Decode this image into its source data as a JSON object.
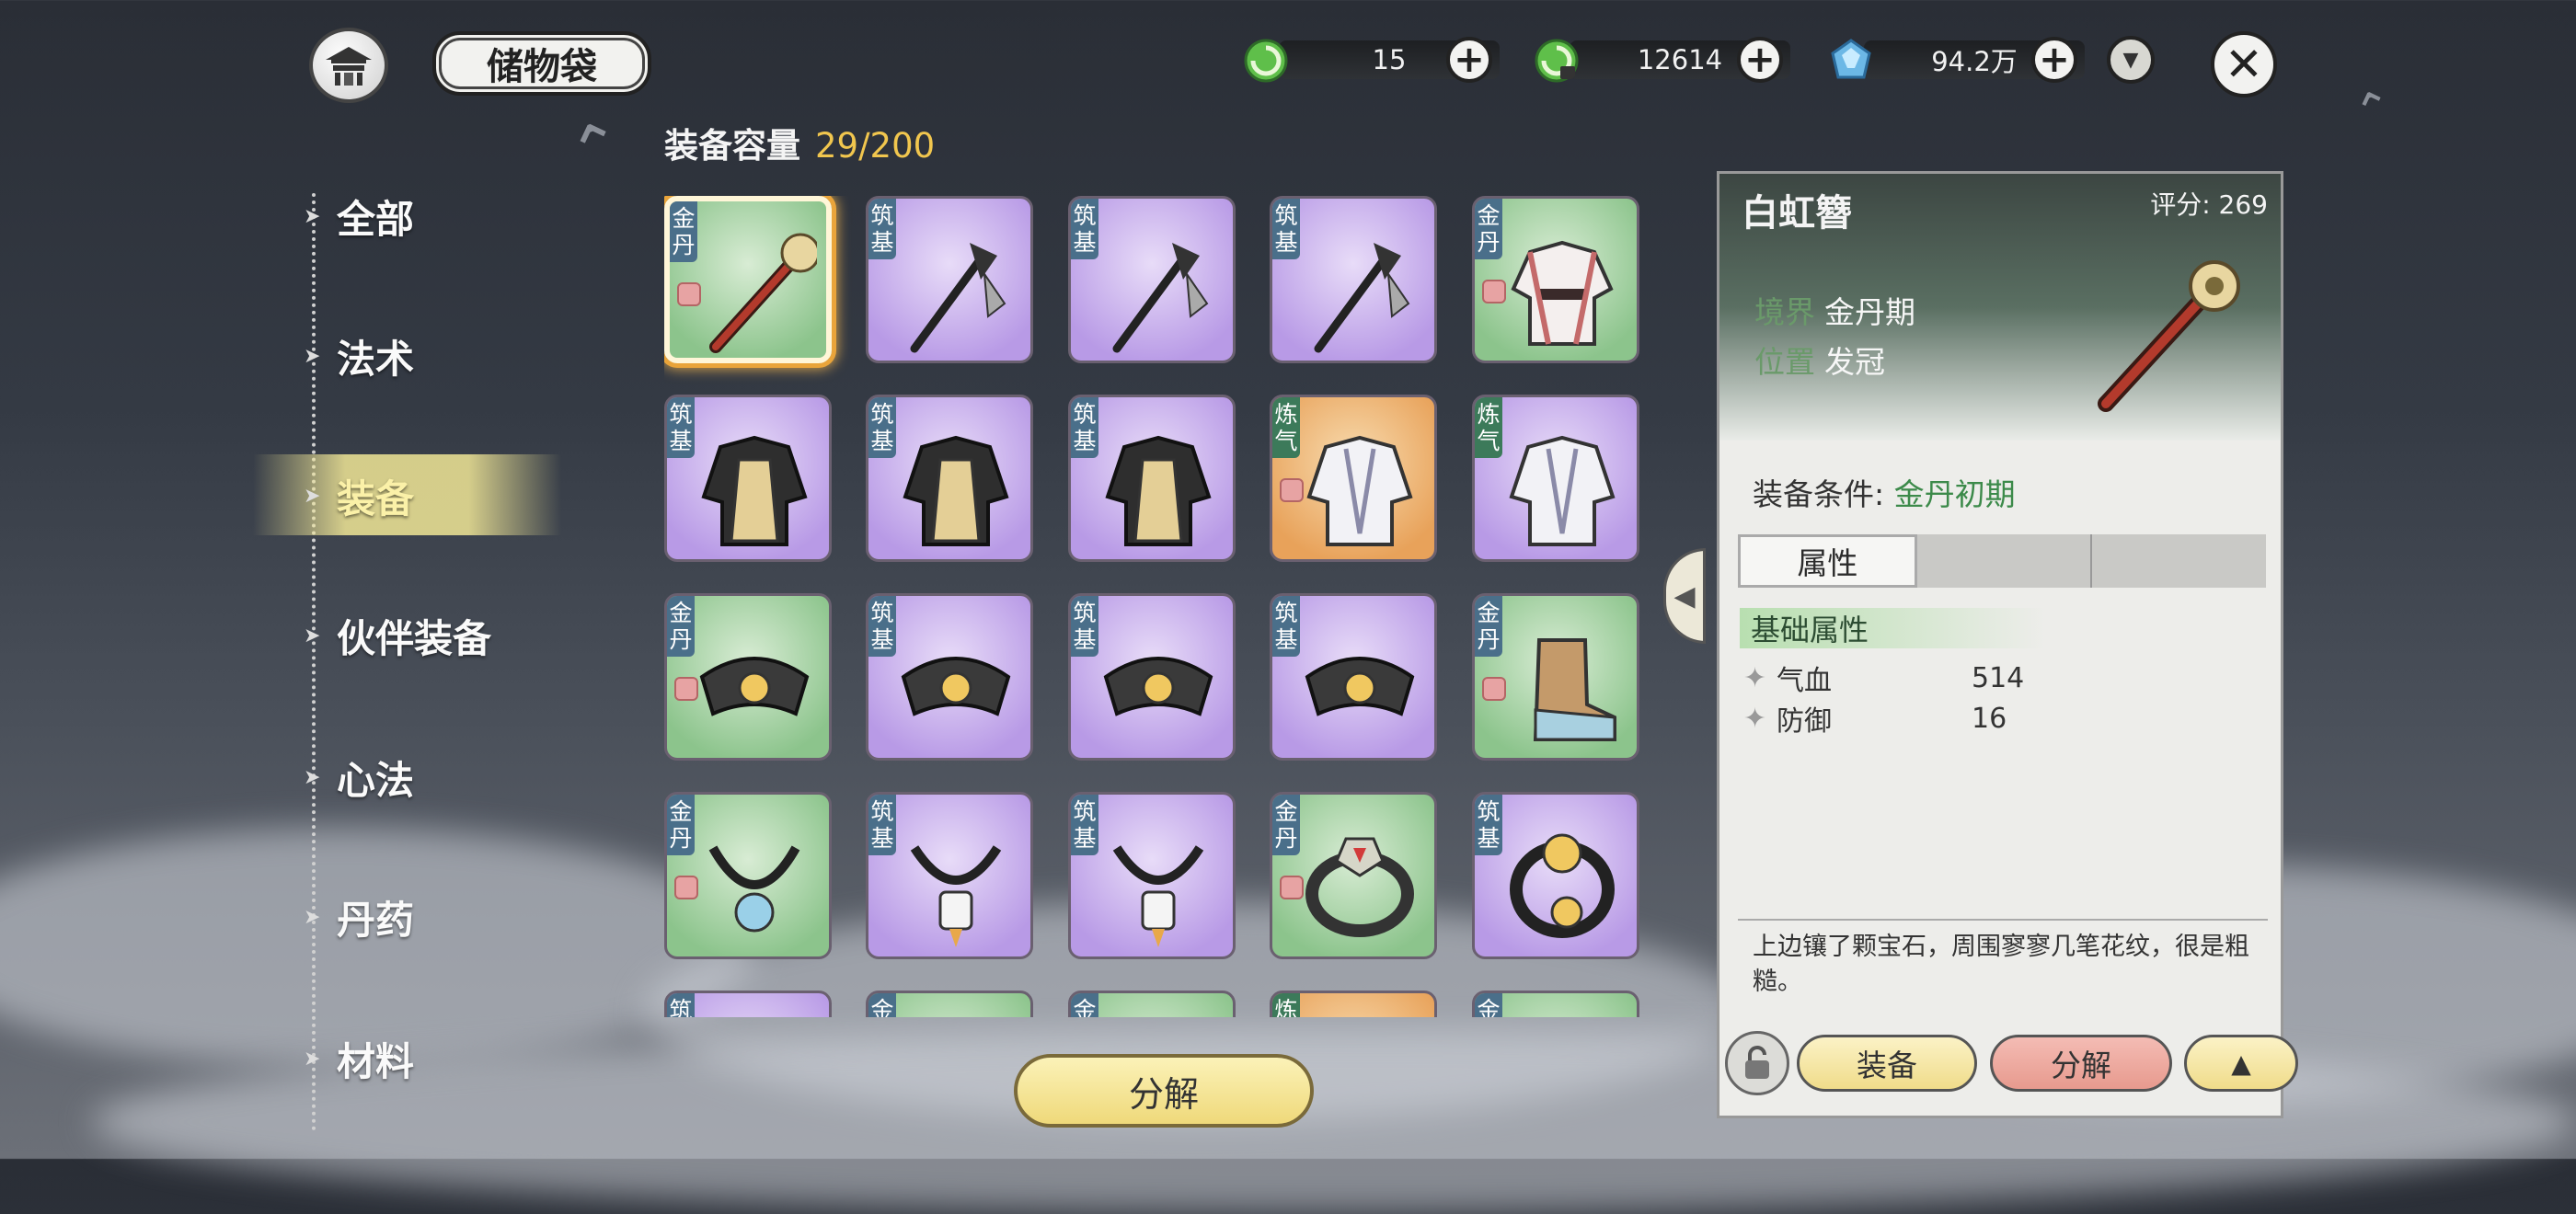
{
  "header": {
    "title": "储物袋",
    "resources": [
      {
        "icon": "green-swirl-icon",
        "value": "15"
      },
      {
        "icon": "green-swirl-locked-icon",
        "value": "12614"
      },
      {
        "icon": "blue-gem-icon",
        "value": "94.2万"
      }
    ]
  },
  "nav": {
    "items": [
      {
        "label": "全部"
      },
      {
        "label": "法术"
      },
      {
        "label": "装备",
        "active": true
      },
      {
        "label": "伙伴装备"
      },
      {
        "label": "心法"
      },
      {
        "label": "丹药"
      },
      {
        "label": "材料"
      }
    ]
  },
  "capacity": {
    "label": "装备容量",
    "value": "29/200"
  },
  "grid": {
    "rows": [
      [
        {
          "tag": "金丹",
          "color": "green",
          "icon": "hairpin-icon",
          "locked": true,
          "selected": true
        },
        {
          "tag": "筑基",
          "color": "purple",
          "icon": "halberd-icon",
          "locked": false
        },
        {
          "tag": "筑基",
          "color": "purple",
          "icon": "halberd-icon",
          "locked": false
        },
        {
          "tag": "筑基",
          "color": "purple",
          "icon": "halberd-icon",
          "locked": false
        },
        {
          "tag": "金丹",
          "color": "green",
          "icon": "robe-icon",
          "locked": true
        }
      ],
      [
        {
          "tag": "筑基",
          "color": "purple",
          "icon": "dark-robe-icon",
          "locked": false
        },
        {
          "tag": "筑基",
          "color": "purple",
          "icon": "dark-robe-icon",
          "locked": false
        },
        {
          "tag": "筑基",
          "color": "purple",
          "icon": "dark-robe-icon",
          "locked": false
        },
        {
          "tag": "炼气",
          "color": "orange",
          "icon": "white-robe-icon",
          "locked": true
        },
        {
          "tag": "炼气",
          "color": "purple",
          "icon": "white-robe-icon",
          "locked": false
        }
      ],
      [
        {
          "tag": "金丹",
          "color": "green",
          "icon": "belt-icon",
          "locked": true
        },
        {
          "tag": "筑基",
          "color": "purple",
          "icon": "belt-icon",
          "locked": false
        },
        {
          "tag": "筑基",
          "color": "purple",
          "icon": "belt-icon",
          "locked": false
        },
        {
          "tag": "筑基",
          "color": "purple",
          "icon": "belt-icon",
          "locked": false
        },
        {
          "tag": "金丹",
          "color": "green",
          "icon": "boot-icon",
          "locked": true
        }
      ],
      [
        {
          "tag": "金丹",
          "color": "green",
          "icon": "necklace-icon",
          "locked": true
        },
        {
          "tag": "筑基",
          "color": "purple",
          "icon": "pendant-icon",
          "locked": false
        },
        {
          "tag": "筑基",
          "color": "purple",
          "icon": "pendant-icon",
          "locked": false
        },
        {
          "tag": "金丹",
          "color": "green",
          "icon": "ring-icon",
          "locked": true
        },
        {
          "tag": "筑基",
          "color": "purple",
          "icon": "bracelet-icon",
          "locked": false
        }
      ],
      [
        {
          "tag": "筑",
          "color": "purple",
          "icon": "item-icon"
        },
        {
          "tag": "金",
          "color": "green",
          "icon": "item-icon"
        },
        {
          "tag": "金",
          "color": "green",
          "icon": "item-icon"
        },
        {
          "tag": "炼",
          "color": "orange",
          "icon": "item-icon"
        },
        {
          "tag": "金",
          "color": "green",
          "icon": "item-icon"
        }
      ]
    ]
  },
  "decompose_button": "分解",
  "detail": {
    "name": "白虹簪",
    "score_label": "评分:",
    "score": "269",
    "realm_label": "境界",
    "realm": "金丹期",
    "slot_label": "位置",
    "slot": "发冠",
    "requirement_label": "装备条件:",
    "requirement": "金丹初期",
    "tabs": [
      "属性",
      "",
      ""
    ],
    "section_title": "基础属性",
    "stats": [
      {
        "name": "气血",
        "value": "514"
      },
      {
        "name": "防御",
        "value": "16"
      }
    ],
    "description": "上边镶了颗宝石，周围寥寥几笔花纹，很是粗糙。",
    "buttons": {
      "equip": "装备",
      "split": "分解",
      "up": "▲"
    }
  },
  "colors": {
    "capacity_value": "#f1c64e",
    "requirement_value": "#3c8a4a",
    "tag_bg": "#4a6f8a"
  }
}
